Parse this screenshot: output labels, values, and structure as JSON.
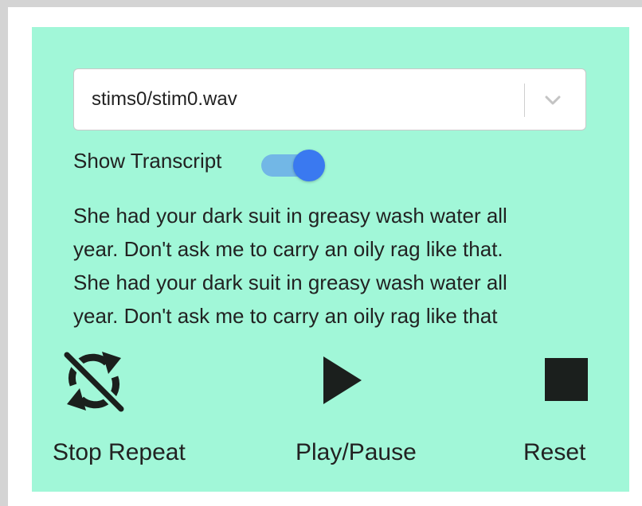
{
  "player": {
    "file_select": {
      "value": "stims0/stim0.wav",
      "chevron_icon": "chevron-down-icon"
    },
    "transcript_toggle": {
      "label": "Show Transcript",
      "checked": true
    },
    "transcript": {
      "lines": [
        "She had your dark suit in greasy wash water all",
        "year. Don't ask me to carry an oily rag like that.",
        "She had your dark suit in greasy wash water all",
        "year. Don't ask me to carry an oily rag like that"
      ]
    },
    "controls": {
      "repeat": {
        "label": "Stop Repeat",
        "icon": "repeat-off-icon"
      },
      "play": {
        "label": "Play/Pause",
        "icon": "play-icon"
      },
      "reset": {
        "label": "Reset",
        "icon": "stop-icon"
      }
    }
  },
  "colors": {
    "panel_background": "#a1f7d8",
    "frame": "#d4d4d4",
    "toggle_track": "#72b7e6",
    "toggle_knob": "#3a79f0",
    "icon": "#1b1f1d",
    "text": "#222222"
  }
}
